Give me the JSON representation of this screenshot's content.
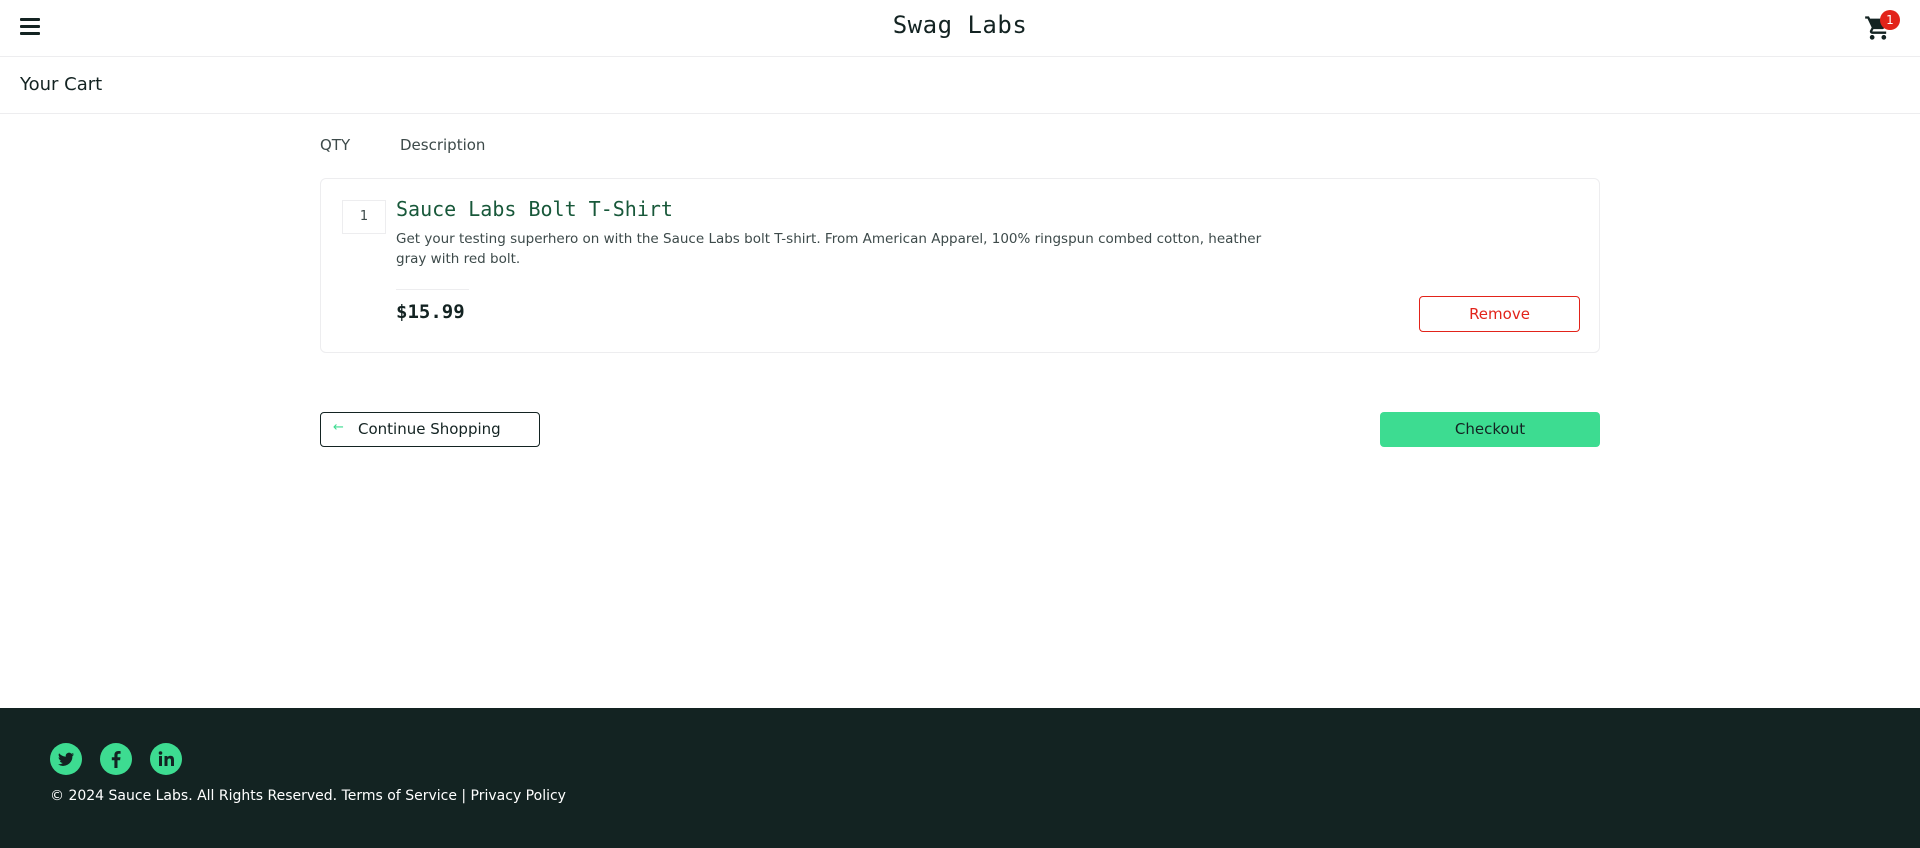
{
  "header": {
    "menu_icon": "hamburger-menu-icon",
    "logo": "Swag Labs",
    "cart_icon": "shopping-cart-icon",
    "cart_badge": "1"
  },
  "sub_header": {
    "title": "Your Cart"
  },
  "cart": {
    "qty_label": "QTY",
    "desc_label": "Description",
    "items": [
      {
        "quantity": "1",
        "name": "Sauce Labs Bolt T-Shirt",
        "description": "Get your testing superhero on with the Sauce Labs bolt T-shirt. From American Apparel, 100% ringspun combed cotton, heather gray with red bolt.",
        "price": "$15.99",
        "remove_label": "Remove"
      }
    ]
  },
  "actions": {
    "continue_label": "Continue Shopping",
    "continue_icon": "arrow-left-icon",
    "checkout_label": "Checkout"
  },
  "footer": {
    "social": [
      "twitter-icon",
      "facebook-icon",
      "linkedin-icon"
    ],
    "copy": "© 2024 Sauce Labs. All Rights Reserved. Terms of Service | Privacy Policy"
  },
  "colors": {
    "accent": "#3ddc91",
    "danger": "#e2231a",
    "dark": "#132322",
    "item_title": "#18583a"
  }
}
